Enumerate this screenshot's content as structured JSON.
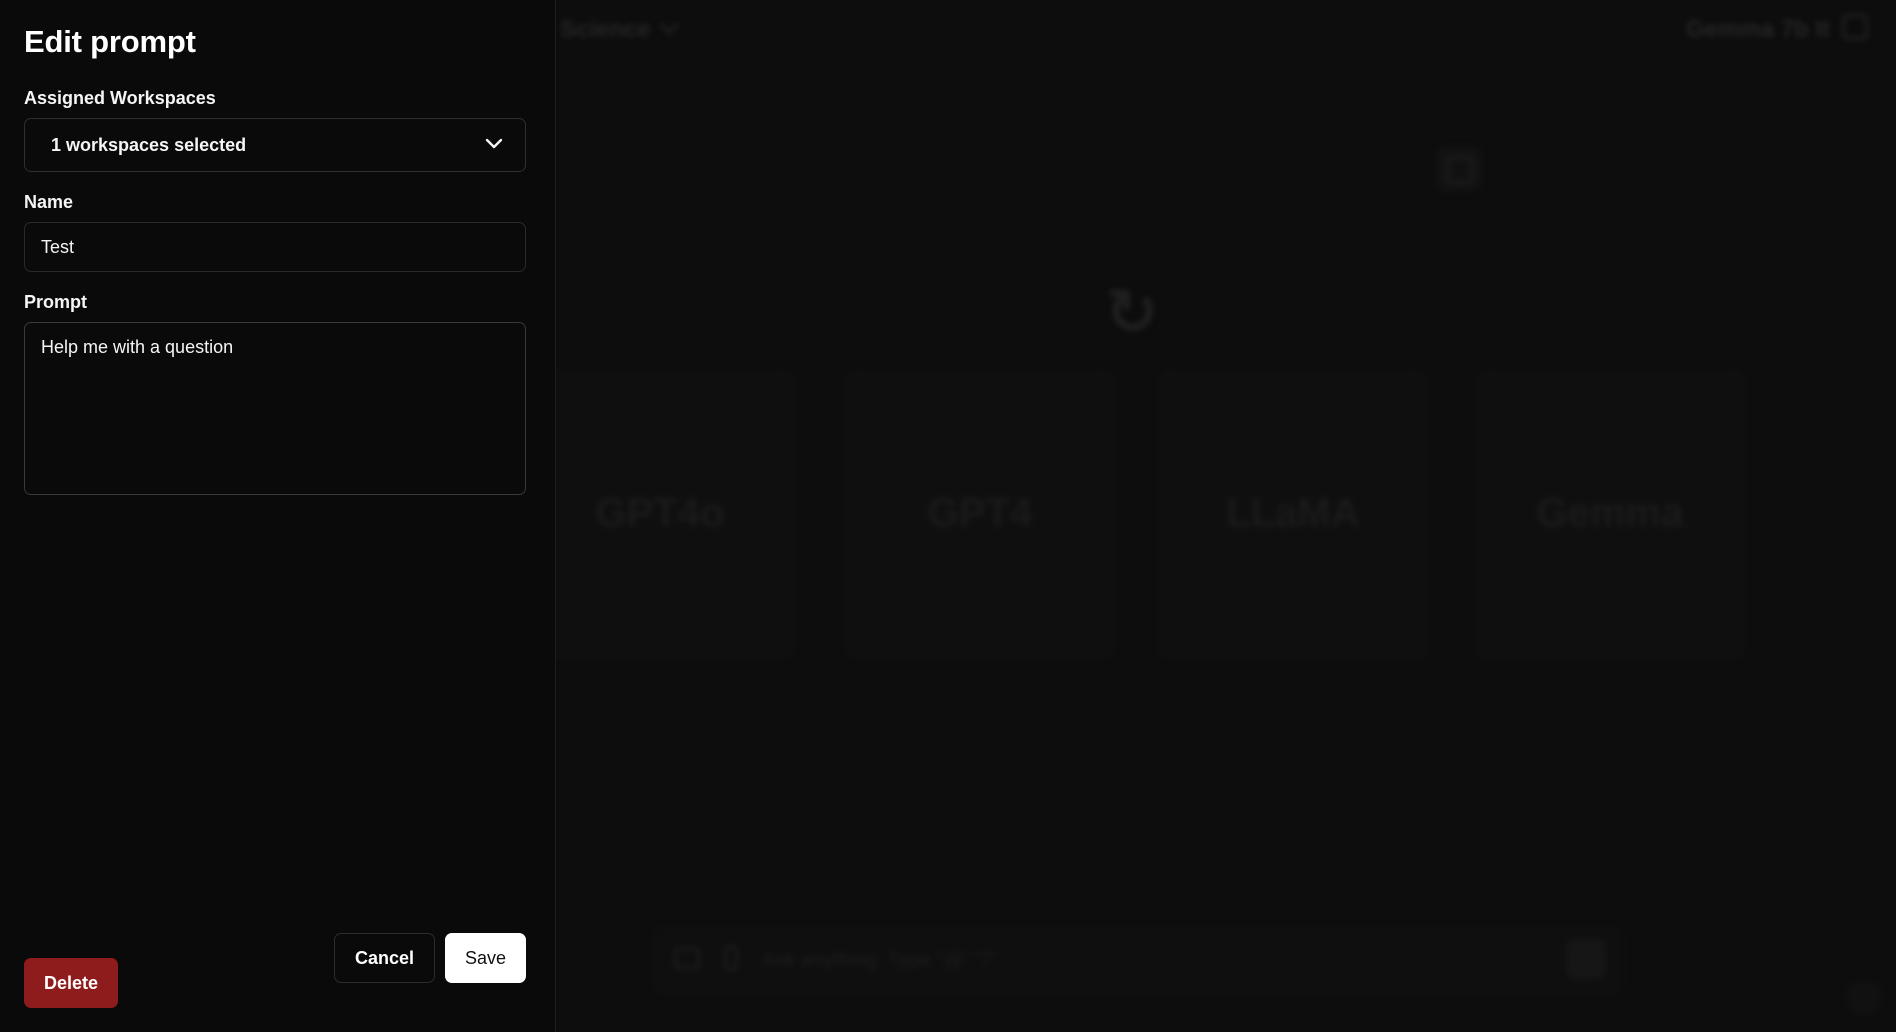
{
  "panel": {
    "title": "Edit prompt",
    "workspaces_label": "Assigned Workspaces",
    "workspaces_value": "1 workspaces selected",
    "name_label": "Name",
    "name_value": "Test",
    "prompt_label": "Prompt",
    "prompt_value": "Help me with a question",
    "delete_label": "Delete",
    "cancel_label": "Cancel",
    "save_label": "Save"
  },
  "background": {
    "workspace_name": "Science",
    "model_selector": "Gemma 7b It",
    "cards": [
      {
        "label": "GPT4o"
      },
      {
        "label": "GPT4"
      },
      {
        "label": "LLaMA"
      },
      {
        "label": "Gemma"
      }
    ],
    "input_placeholder": "Ask anything. Type \"@\" \"/\""
  },
  "colors": {
    "panel_bg": "#0a0a0a",
    "delete_bg": "#8e1c1c",
    "save_bg": "#ffffff"
  },
  "icons": {
    "select_chevron": "chevron-down-icon"
  }
}
